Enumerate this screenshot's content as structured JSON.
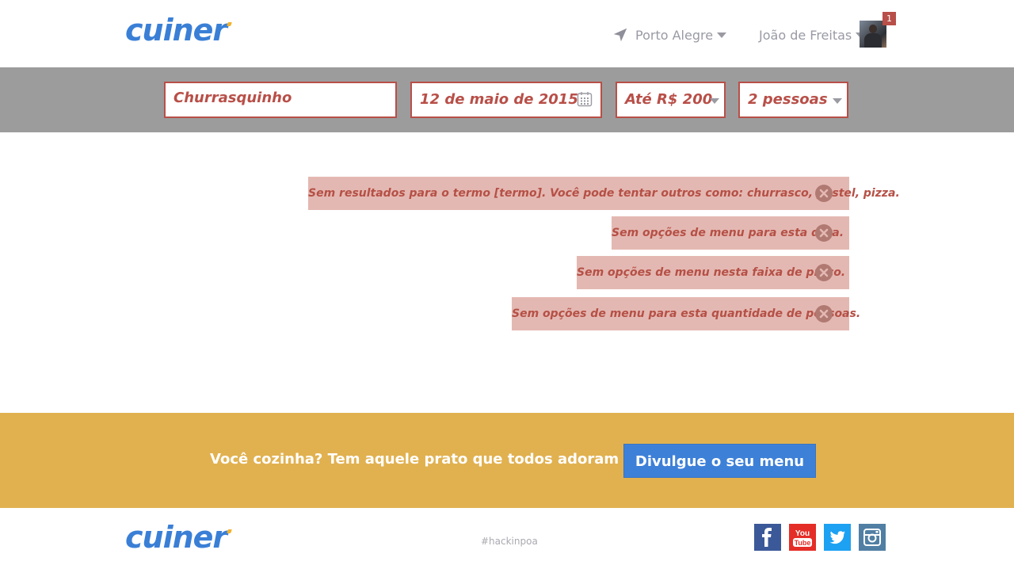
{
  "header": {
    "logo": "cuiner",
    "location": "Porto Alegre",
    "user_name": "João de Freitas",
    "notification_count": "1"
  },
  "search": {
    "term": "Churrasquinho",
    "date": "12 de maio de 2015",
    "price": "Até R$ 200",
    "people": "2 pessoas"
  },
  "messages": [
    {
      "text": "Sem resultados para o termo [termo]. Você pode tentar outros como: churrasco, pastel, pizza."
    },
    {
      "text": "Sem opções de menu para esta data."
    },
    {
      "text": "Sem opções de menu nesta faixa de preço."
    },
    {
      "text": "Sem opções de menu para esta quantidade de pessoas."
    }
  ],
  "cta": {
    "text": "Você cozinha? Tem aquele prato que todos adoram comer?",
    "button_label": "Divulgue o seu menu"
  },
  "footer": {
    "logo": "cuiner",
    "hashtag": "#hackinpoa",
    "social": [
      {
        "name": "facebook-icon",
        "color": "#3b5998"
      },
      {
        "name": "youtube-icon",
        "color": "#e52d27"
      },
      {
        "name": "twitter-icon",
        "color": "#1da1f2"
      },
      {
        "name": "instagram-icon",
        "color": "#517fa4"
      }
    ]
  },
  "colors": {
    "brand_blue": "#3a7fd6",
    "accent_red": "#b84f48",
    "message_bg": "#e4b8b2",
    "cta_bg": "#e1b150",
    "searchbar_bg": "#9c9c9c"
  }
}
